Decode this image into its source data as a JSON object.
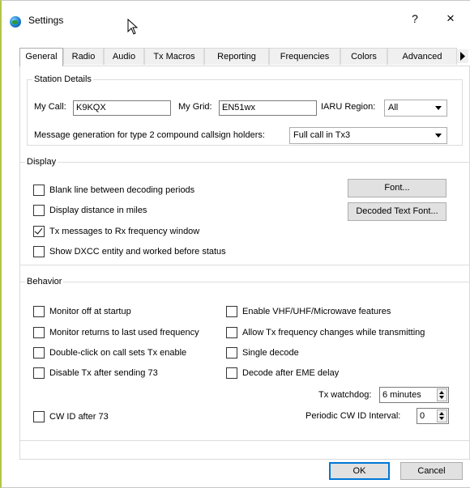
{
  "window": {
    "title": "Settings",
    "help": "?",
    "close": "×"
  },
  "tabs": [
    "General",
    "Radio",
    "Audio",
    "Tx Macros",
    "Reporting",
    "Frequencies",
    "Colors",
    "Advanced"
  ],
  "station": {
    "title": "Station Details",
    "my_call_label": "My Call:",
    "my_call": "K9KQX",
    "my_grid_label": "My Grid:",
    "my_grid": "EN51wx",
    "iaru_label": "IARU Region:",
    "iaru": "All",
    "msg_label": "Message generation for type 2 compound callsign holders:",
    "msg_value": "Full call in Tx3"
  },
  "display": {
    "title": "Display",
    "checkboxes": [
      {
        "label": "Blank line between decoding periods",
        "checked": false
      },
      {
        "label": "Display distance in miles",
        "checked": false
      },
      {
        "label": "Tx messages to Rx frequency window",
        "checked": true
      },
      {
        "label": "Show DXCC entity and worked before status",
        "checked": false
      }
    ],
    "font_button": "Font...",
    "decoded_font_button": "Decoded Text Font..."
  },
  "behavior": {
    "title": "Behavior",
    "left": [
      {
        "label": "Monitor off at startup",
        "checked": false
      },
      {
        "label": "Monitor returns to last used frequency",
        "checked": false
      },
      {
        "label": "Double-click on call sets Tx enable",
        "checked": false
      },
      {
        "label": "Disable Tx after sending 73",
        "checked": false
      }
    ],
    "right": [
      {
        "label": "Enable VHF/UHF/Microwave features",
        "checked": false
      },
      {
        "label": "Allow Tx frequency changes while transmitting",
        "checked": false
      },
      {
        "label": "Single decode",
        "checked": false
      },
      {
        "label": "Decode after EME delay",
        "checked": false
      }
    ],
    "tx_watchdog_label": "Tx watchdog:",
    "tx_watchdog_value": "6 minutes",
    "cw_id": {
      "label": "CW ID after 73",
      "checked": false
    },
    "periodic_label": "Periodic CW ID Interval:",
    "periodic_value": "0"
  },
  "buttons": {
    "ok": "OK",
    "cancel": "Cancel"
  }
}
